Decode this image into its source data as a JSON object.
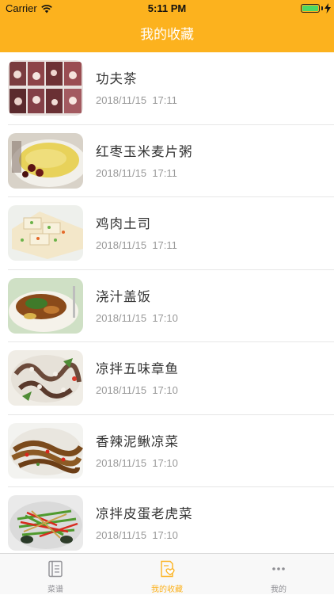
{
  "status_bar": {
    "carrier": "Carrier",
    "time": "5:11 PM"
  },
  "nav": {
    "title": "我的收藏"
  },
  "favorites": [
    {
      "title": "功夫茶",
      "date": "2018/11/15  17:11",
      "image": "tea-ceremony-photo"
    },
    {
      "title": "红枣玉米麦片粥",
      "date": "2018/11/15  17:11",
      "image": "porridge-photo"
    },
    {
      "title": "鸡肉土司",
      "date": "2018/11/15  17:11",
      "image": "chicken-toast-photo"
    },
    {
      "title": "浇汁盖饭",
      "date": "2018/11/15  17:10",
      "image": "rice-bowl-photo"
    },
    {
      "title": "凉拌五味章鱼",
      "date": "2018/11/15  17:10",
      "image": "octopus-salad-photo"
    },
    {
      "title": "香辣泥鳅凉菜",
      "date": "2018/11/15  17:10",
      "image": "spicy-loach-photo"
    },
    {
      "title": "凉拌皮蛋老虎菜",
      "date": "2018/11/15  17:10",
      "image": "egg-salad-photo"
    }
  ],
  "tabs": [
    {
      "label": "菜谱",
      "icon": "book-icon",
      "active": false
    },
    {
      "label": "我的收藏",
      "icon": "favorites-icon",
      "active": true
    },
    {
      "label": "我的",
      "icon": "more-icon",
      "active": false
    }
  ],
  "colors": {
    "accent": "#fcb21e",
    "tab_inactive": "#8e8e93"
  }
}
